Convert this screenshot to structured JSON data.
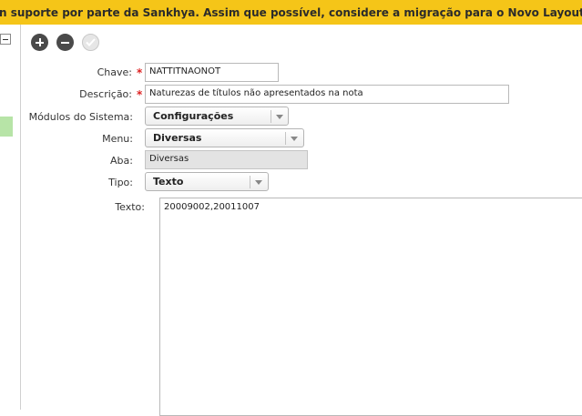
{
  "banner": {
    "message": "n suporte por parte da Sankhya. Assim que possível, considere a migração para o Novo Layout que já es"
  },
  "toolbar": {
    "add_icon": "plus-circle-icon",
    "remove_icon": "minus-circle-icon",
    "confirm_icon": "check-circle-icon"
  },
  "form": {
    "chave": {
      "label": "Chave:",
      "required_mark": "*",
      "value": "NATTITNAONOT"
    },
    "descricao": {
      "label": "Descrição:",
      "required_mark": "*",
      "value": "Naturezas de títulos não apresentados na nota"
    },
    "modulos": {
      "label": "Módulos do Sistema:",
      "value": "Configurações"
    },
    "menu": {
      "label": "Menu:",
      "value": "Diversas"
    },
    "aba": {
      "label": "Aba:",
      "value": "Diversas"
    },
    "tipo": {
      "label": "Tipo:",
      "value": "Texto"
    },
    "texto": {
      "label": "Texto:",
      "value": "20009002,20011007"
    }
  },
  "colors": {
    "banner_bg": "#f5c518",
    "required": "#dd2222",
    "readonly_bg": "#e3e3e3"
  }
}
